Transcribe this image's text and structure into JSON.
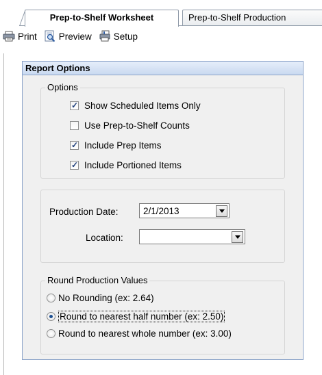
{
  "tabs": [
    {
      "label": "Prep-to-Shelf Worksheet",
      "active": true
    },
    {
      "label": "Prep-to-Shelf Production",
      "active": false
    }
  ],
  "toolbar": {
    "print_label": "Print",
    "preview_label": "Preview",
    "setup_label": "Setup"
  },
  "panel": {
    "title": "Report Options",
    "options_group": {
      "title": "Options",
      "items": [
        {
          "label": "Show Scheduled Items Only",
          "checked": true
        },
        {
          "label": "Use Prep-to-Shelf Counts",
          "checked": false
        },
        {
          "label": "Include Prep Items",
          "checked": true
        },
        {
          "label": "Include Portioned Items",
          "checked": true
        }
      ]
    },
    "production_date_label": "Production Date:",
    "production_date_value": "2/1/2013",
    "location_label": "Location:",
    "location_value": "",
    "rounding_group": {
      "title": "Round Production Values",
      "options": [
        {
          "label": "No Rounding (ex: 2.64)",
          "selected": false
        },
        {
          "label": "Round to nearest half number (ex: 2.50)",
          "selected": true
        },
        {
          "label": "Round to nearest whole number (ex: 3.00)",
          "selected": false
        }
      ]
    }
  },
  "colors": {
    "panel_border": "#8aa2c8",
    "panel_header": "#c9d9f0",
    "check_tick": "#1c3d7a",
    "radio_dot": "#1d4f91"
  }
}
